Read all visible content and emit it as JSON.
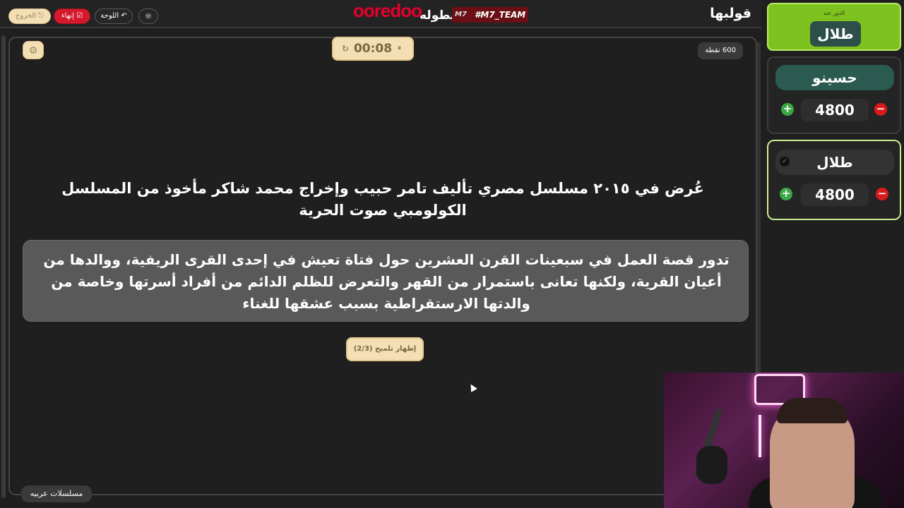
{
  "header": {
    "logo": "قولبها",
    "brand": {
      "sponsor": "ooredoo",
      "tournament": "بطوله",
      "team_tag": "#M7_TEAM",
      "team_mark": "M7"
    },
    "buttons": {
      "exit": "الخروج",
      "end": "إنهاء",
      "board": "اللوحة",
      "theme_icon": "☼"
    }
  },
  "stage": {
    "points": "600 نقطة",
    "settings_icon": "⚙",
    "timer": "00:08",
    "timer_reset_icon": "↻",
    "timer_pause_icon": "⏸",
    "question": "عُرض في ٢٠١٥ مسلسل مصري تأليف تامر حبيب وإخراج محمد شاكر مأخوذ من المسلسل الكولومبي صوت الحرية",
    "hint": "تدور قصة العمل في سبعينات القرن العشرين حول فتاة تعيش في إحدى القرى الريفية، ووالدها من أعيان القرية، ولكنها تعانى باستمرار من القهر والتعرض للظلم الدائم من أفراد أسرتها وخاصة من والدتها الارستقراطية بسبب عشقها للغناء",
    "hint_button": "إظهار تلميح (2/3)",
    "category": "مسلسلات عربيه"
  },
  "sidebar": {
    "turn_label": "الدور عند",
    "turn_name": "طلال",
    "teams": [
      {
        "name": "حسينو",
        "score": "4800",
        "plus": "+",
        "minus": "−"
      },
      {
        "name": "طلال",
        "score": "4800",
        "plus": "+",
        "minus": "−",
        "active_icon": "✓"
      }
    ]
  },
  "colors": {
    "accent_gold": "#f3dfb3",
    "danger": "#d4192c",
    "turn_green": "#7dc21e",
    "team_teal": "#2a5a50",
    "active_border": "#c9ee8f"
  }
}
